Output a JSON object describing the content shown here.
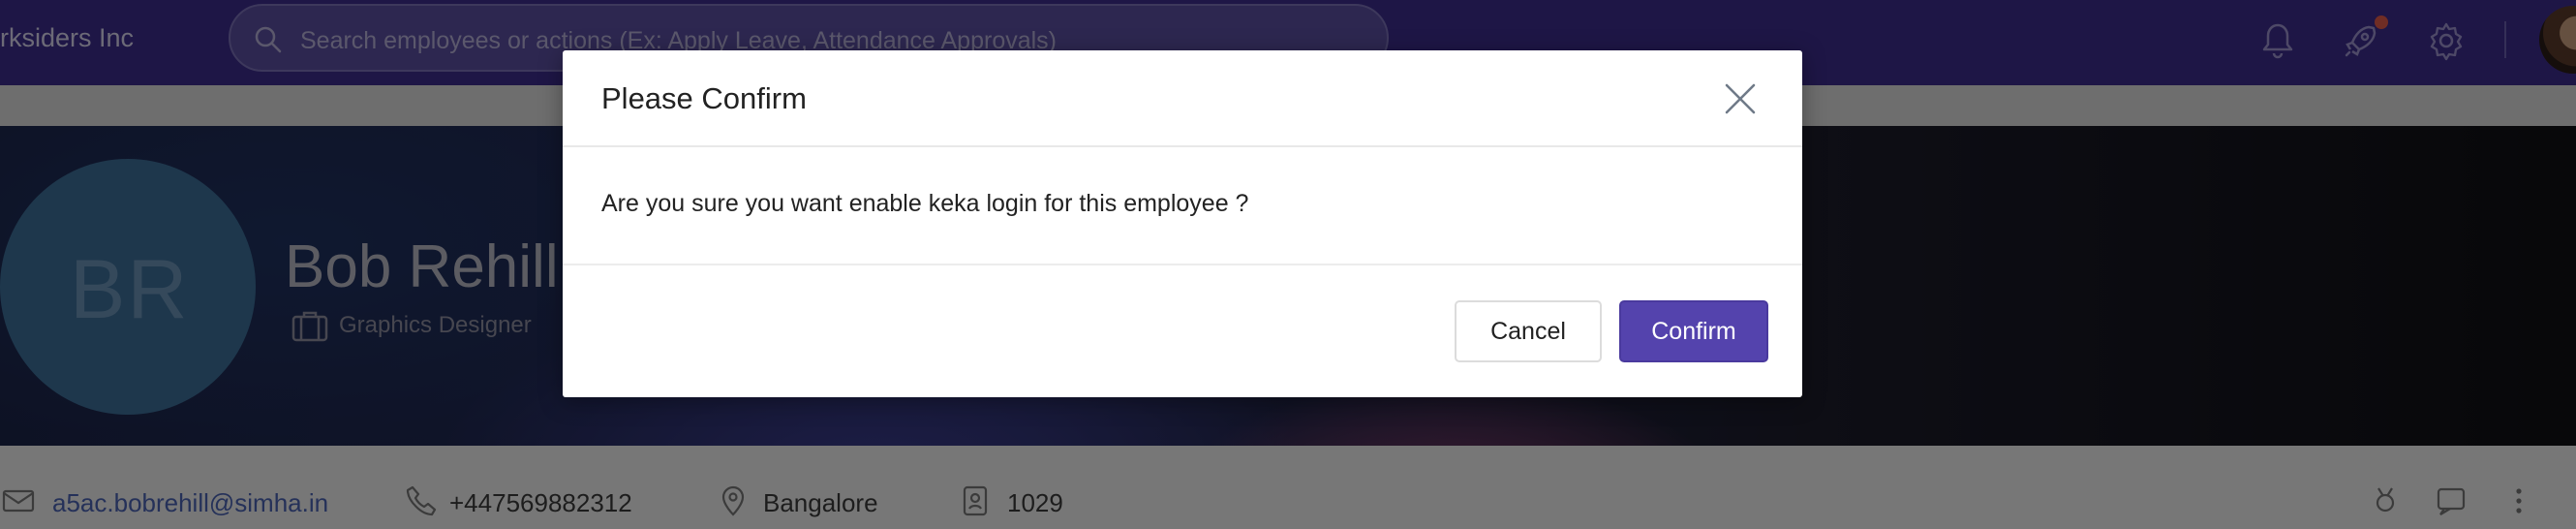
{
  "topbar": {
    "org_name": "rksiders Inc",
    "search_placeholder": "Search employees or actions (Ex: Apply Leave, Attendance Approvals)"
  },
  "profile": {
    "initials": "BR",
    "name": "Bob Rehill",
    "role": "Graphics Designer",
    "email": "a5ac.bobrehill@simha.in",
    "phone": "+447569882312",
    "location": "Bangalore",
    "employee_id": "1029"
  },
  "modal": {
    "title": "Please Confirm",
    "message": "Are you sure you want enable keka login for this employee ?",
    "cancel_label": "Cancel",
    "confirm_label": "Confirm"
  },
  "colors": {
    "brand": "#3d2d8c",
    "confirm_button": "#5443ad",
    "avatar": "#3d6f99"
  },
  "icons": [
    "search-icon",
    "bell-icon",
    "rocket-icon",
    "gear-icon",
    "briefcase-icon",
    "mail-icon",
    "phone-icon",
    "location-icon",
    "id-card-icon",
    "medal-icon",
    "chat-icon",
    "more-icon",
    "close-icon"
  ]
}
